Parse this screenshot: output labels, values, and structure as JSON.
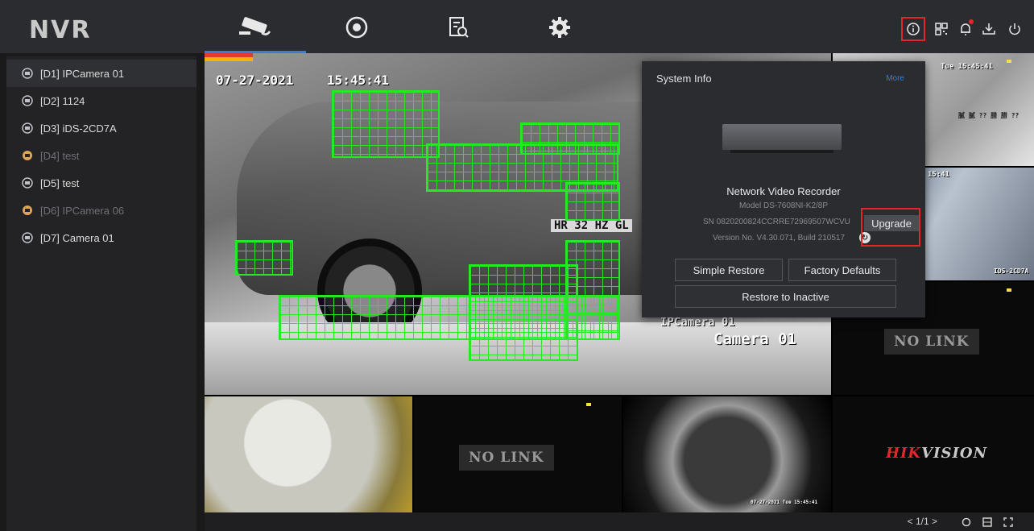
{
  "app": {
    "logo": "NVR"
  },
  "nav_tabs": [
    {
      "name": "live-view",
      "icon": "camera-icon",
      "active": true
    },
    {
      "name": "playback",
      "icon": "playback-icon",
      "active": false
    },
    {
      "name": "search",
      "icon": "file-search-icon",
      "active": false
    },
    {
      "name": "settings",
      "icon": "gear-icon",
      "active": false
    }
  ],
  "toolbar_icons": [
    "info-icon",
    "qr-code-icon",
    "bell-icon",
    "download-icon",
    "power-icon"
  ],
  "cameras": [
    {
      "label": "[D1] IPCamera 01",
      "state": "selected"
    },
    {
      "label": "[D2] 1124",
      "state": "online"
    },
    {
      "label": "[D3] iDS-2CD7A",
      "state": "online"
    },
    {
      "label": "[D4] test",
      "state": "offline"
    },
    {
      "label": "[D5] test",
      "state": "online"
    },
    {
      "label": "[D6] IPCamera 06",
      "state": "offline"
    },
    {
      "label": "[D7] Camera 01",
      "state": "online"
    }
  ],
  "main_video": {
    "osd_time": "07-27-2021",
    "osd_clock": "15:45:41",
    "plate": "HR 32 HZ GL",
    "channel_name_small": "IPCamera 01",
    "channel_name_large": "Camera 01"
  },
  "side_tiles": {
    "top_right_osd": "Tue 15:45:41",
    "top_right_text": "腻 腻  ?? 腊 腊 ??",
    "mid_right_time": "15:41",
    "mid_right_label": "IDS-2CD7A",
    "nolink_1": "NO LINK",
    "nolink_2": "NO LINK",
    "fisheye_osd": "07-27-2021 Tue 15:45:41",
    "brand_hik": "HIK",
    "brand_vision": "VISION"
  },
  "system_info": {
    "title": "System Info",
    "more": "More",
    "device_name": "Network Video Recorder",
    "model": "Model DS-7608NI-K2/8P",
    "serial": "SN 0820200824CCRRE72969507WCVU",
    "version": "Version No. V4.30.071, Build 210517",
    "upgrade_label": "Upgrade",
    "simple_restore": "Simple Restore",
    "factory_defaults": "Factory Defaults",
    "restore_inactive": "Restore to Inactive"
  },
  "bottom_bar": {
    "page": "1/1"
  }
}
